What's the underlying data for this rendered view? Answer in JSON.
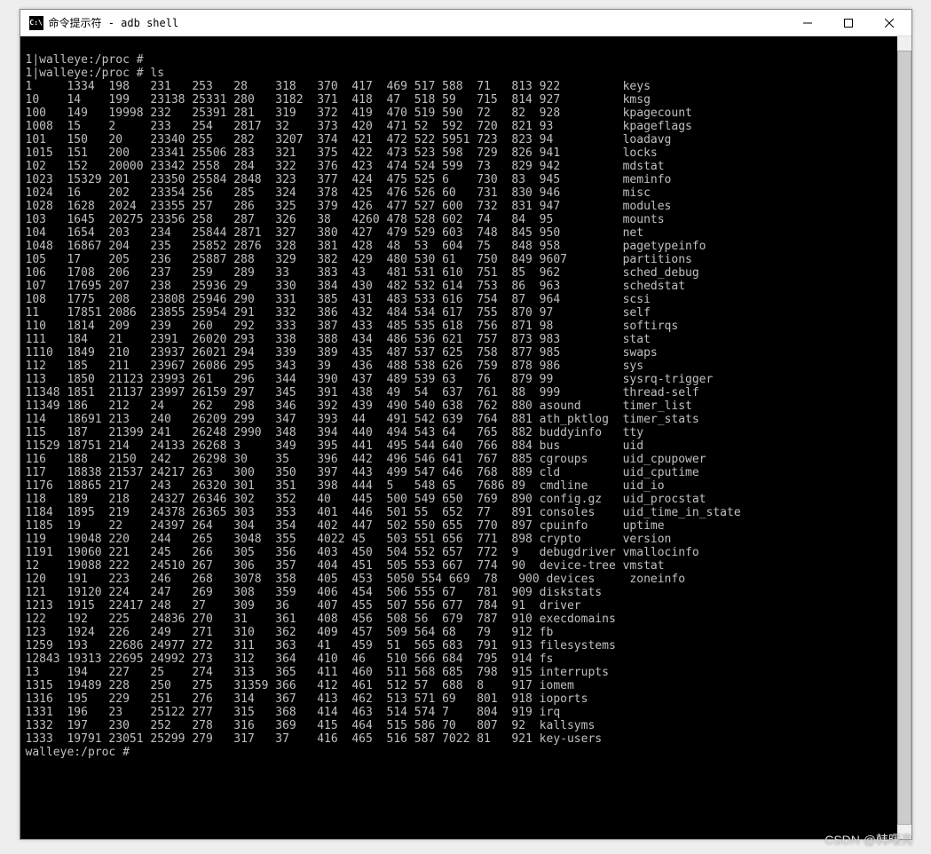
{
  "title": "命令提示符 - adb  shell",
  "prompt1": "1|walleye:/proc #",
  "prompt2": "1|walleye:/proc # ls",
  "prompt3": "walleye:/proc #",
  "cols": [
    [
      "1",
      "10",
      "100",
      "1008",
      "101",
      "1015",
      "102",
      "1023",
      "1024",
      "1028",
      "103",
      "104",
      "1048",
      "105",
      "106",
      "107",
      "108",
      "11",
      "110",
      "111",
      "1110",
      "112",
      "113",
      "11348",
      "11349",
      "114",
      "115",
      "11529",
      "116",
      "117",
      "1176",
      "118",
      "1184",
      "1185",
      "119",
      "1191",
      "12",
      "120",
      "121",
      "1213",
      "122",
      "123",
      "1259",
      "12843",
      "13",
      "1315",
      "1316",
      "1331",
      "1332",
      "1333"
    ],
    [
      "1334",
      "14",
      "149",
      "15",
      "150",
      "151",
      "152",
      "15329",
      "16",
      "1628",
      "1645",
      "1654",
      "16867",
      "17",
      "1708",
      "17695",
      "1775",
      "17851",
      "1814",
      "184",
      "1849",
      "185",
      "1850",
      "1851",
      "186",
      "18691",
      "187",
      "18751",
      "188",
      "18838",
      "18865",
      "189",
      "1895",
      "19",
      "19048",
      "19060",
      "19088",
      "191",
      "19120",
      "1915",
      "192",
      "1924",
      "193",
      "19313",
      "194",
      "19489",
      "195",
      "196",
      "197",
      "19791"
    ],
    [
      "198",
      "199",
      "19998",
      "2",
      "20",
      "200",
      "20000",
      "201",
      "202",
      "2024",
      "20275",
      "203",
      "204",
      "205",
      "206",
      "207",
      "208",
      "2086",
      "209",
      "21",
      "210",
      "211",
      "21123",
      "21137",
      "212",
      "213",
      "21399",
      "214",
      "2150",
      "21537",
      "217",
      "218",
      "219",
      "22",
      "220",
      "221",
      "222",
      "223",
      "224",
      "22417",
      "225",
      "226",
      "22686",
      "22695",
      "227",
      "228",
      "229",
      "23",
      "230",
      "23051"
    ],
    [
      "231",
      "23138",
      "232",
      "233",
      "23340",
      "23341",
      "23342",
      "23350",
      "23354",
      "23355",
      "23356",
      "234",
      "235",
      "236",
      "237",
      "238",
      "23808",
      "23855",
      "239",
      "2391",
      "23937",
      "23967",
      "23993",
      "23997",
      "24",
      "240",
      "241",
      "24133",
      "242",
      "24217",
      "243",
      "24327",
      "24378",
      "24397",
      "244",
      "245",
      "24510",
      "246",
      "247",
      "248",
      "24836",
      "249",
      "24977",
      "24992",
      "25",
      "250",
      "251",
      "25122",
      "252",
      "25299"
    ],
    [
      "253",
      "25331",
      "25391",
      "254",
      "255",
      "25506",
      "2558",
      "25584",
      "256",
      "257",
      "258",
      "25844",
      "25852",
      "25887",
      "259",
      "25936",
      "25946",
      "25954",
      "260",
      "26020",
      "26021",
      "26086",
      "261",
      "26159",
      "262",
      "26209",
      "26248",
      "26268",
      "26298",
      "263",
      "26320",
      "26346",
      "26365",
      "264",
      "265",
      "266",
      "267",
      "268",
      "269",
      "27",
      "270",
      "271",
      "272",
      "273",
      "274",
      "275",
      "276",
      "277",
      "278",
      "279"
    ],
    [
      "28",
      "280",
      "281",
      "2817",
      "282",
      "283",
      "284",
      "2848",
      "285",
      "286",
      "287",
      "2871",
      "2876",
      "288",
      "289",
      "29",
      "290",
      "291",
      "292",
      "293",
      "294",
      "295",
      "296",
      "297",
      "298",
      "299",
      "2990",
      "3",
      "30",
      "300",
      "301",
      "302",
      "303",
      "304",
      "3048",
      "305",
      "306",
      "3078",
      "308",
      "309",
      "31",
      "310",
      "311",
      "312",
      "313",
      "31359",
      "314",
      "315",
      "316",
      "317"
    ],
    [
      "318",
      "3182",
      "319",
      "32",
      "3207",
      "321",
      "322",
      "323",
      "324",
      "325",
      "326",
      "327",
      "328",
      "329",
      "33",
      "330",
      "331",
      "332",
      "333",
      "338",
      "339",
      "343",
      "344",
      "345",
      "346",
      "347",
      "348",
      "349",
      "35",
      "350",
      "351",
      "352",
      "353",
      "354",
      "355",
      "356",
      "357",
      "358",
      "359",
      "36",
      "361",
      "362",
      "363",
      "364",
      "365",
      "366",
      "367",
      "368",
      "369",
      "37"
    ],
    [
      "370",
      "371",
      "372",
      "373",
      "374",
      "375",
      "376",
      "377",
      "378",
      "379",
      "38",
      "380",
      "381",
      "382",
      "383",
      "384",
      "385",
      "386",
      "387",
      "388",
      "389",
      "39",
      "390",
      "391",
      "392",
      "393",
      "394",
      "395",
      "396",
      "397",
      "398",
      "40",
      "401",
      "402",
      "4022",
      "403",
      "404",
      "405",
      "406",
      "407",
      "408",
      "409",
      "41",
      "410",
      "411",
      "412",
      "413",
      "414",
      "415",
      "416"
    ],
    [
      "417",
      "418",
      "419",
      "420",
      "421",
      "422",
      "423",
      "424",
      "425",
      "426",
      "4260",
      "427",
      "428",
      "429",
      "43",
      "430",
      "431",
      "432",
      "433",
      "434",
      "435",
      "436",
      "437",
      "438",
      "439",
      "44",
      "440",
      "441",
      "442",
      "443",
      "444",
      "445",
      "446",
      "447",
      "45",
      "450",
      "451",
      "453",
      "454",
      "455",
      "456",
      "457",
      "459",
      "46",
      "460",
      "461",
      "462",
      "463",
      "464",
      "465"
    ],
    [
      "469",
      "47",
      "470",
      "471",
      "472",
      "473",
      "474",
      "475",
      "476",
      "477",
      "478",
      "479",
      "48",
      "480",
      "481",
      "482",
      "483",
      "484",
      "485",
      "486",
      "487",
      "488",
      "489",
      "49",
      "490",
      "491",
      "494",
      "495",
      "496",
      "499",
      "5",
      "500",
      "501",
      "502",
      "503",
      "504",
      "505",
      "5050",
      "506",
      "507",
      "508",
      "509",
      "51",
      "510",
      "511",
      "512",
      "513",
      "514",
      "515",
      "516"
    ],
    [
      "517",
      "518",
      "519",
      "52",
      "522",
      "523",
      "524",
      "525",
      "526",
      "527",
      "528",
      "529",
      "53",
      "530",
      "531",
      "532",
      "533",
      "534",
      "535",
      "536",
      "537",
      "538",
      "539",
      "54",
      "540",
      "542",
      "543",
      "544",
      "546",
      "547",
      "548",
      "549",
      "55",
      "550",
      "551",
      "552",
      "553",
      "554",
      "555",
      "556",
      "56",
      "564",
      "565",
      "566",
      "568",
      "57",
      "571",
      "574",
      "586",
      "587"
    ],
    [
      "588",
      "59",
      "590",
      "592",
      "5951",
      "598",
      "599",
      "6",
      "60",
      "600",
      "602",
      "603",
      "604",
      "61",
      "610",
      "614",
      "616",
      "617",
      "618",
      "621",
      "625",
      "626",
      "63",
      "637",
      "638",
      "639",
      "64",
      "640",
      "641",
      "646",
      "65",
      "650",
      "652",
      "655",
      "656",
      "657",
      "667",
      "669",
      "67",
      "677",
      "679",
      "68",
      "683",
      "684",
      "685",
      "688",
      "69",
      "7",
      "70",
      "7022"
    ],
    [
      "71",
      "715",
      "72",
      "720",
      "723",
      "729",
      "73",
      "730",
      "731",
      "732",
      "74",
      "748",
      "75",
      "750",
      "751",
      "753",
      "754",
      "755",
      "756",
      "757",
      "758",
      "759",
      "76",
      "761",
      "762",
      "764",
      "765",
      "766",
      "767",
      "768",
      "7686",
      "769",
      "77",
      "770",
      "771",
      "772",
      "774",
      "78",
      "781",
      "784",
      "787",
      "79",
      "791",
      "795",
      "798",
      "8",
      "801",
      "804",
      "807",
      "81"
    ],
    [
      "813",
      "814",
      "82",
      "821",
      "823",
      "826",
      "829",
      "83",
      "830",
      "831",
      "84",
      "845",
      "848",
      "849",
      "85",
      "86",
      "87",
      "870",
      "871",
      "873",
      "877",
      "878",
      "879",
      "88",
      "880",
      "881",
      "882",
      "884",
      "885",
      "889",
      "89",
      "890",
      "891",
      "897",
      "898",
      "9",
      "90",
      "900",
      "909",
      "91",
      "910",
      "912",
      "913",
      "914",
      "915",
      "917",
      "918",
      "919",
      "92",
      "921"
    ],
    [
      "922",
      "927",
      "928",
      "93",
      "94",
      "941",
      "942",
      "945",
      "946",
      "947",
      "95",
      "950",
      "958",
      "9607",
      "962",
      "963",
      "964",
      "97",
      "98",
      "983",
      "985",
      "986",
      "99",
      "999",
      "asound",
      "ath_pktlog",
      "buddyinfo",
      "bus",
      "cgroups",
      "cld",
      "cmdline",
      "config.gz",
      "consoles",
      "cpuinfo",
      "crypto",
      "debugdriver",
      "device-tree",
      "devices",
      "diskstats",
      "driver",
      "execdomains",
      "fb",
      "filesystems",
      "fs",
      "interrupts",
      "iomem",
      "ioports",
      "irq",
      "kallsyms",
      "key-users"
    ],
    [
      "keys",
      "kmsg",
      "kpagecount",
      "kpageflags",
      "loadavg",
      "locks",
      "mdstat",
      "meminfo",
      "misc",
      "modules",
      "mounts",
      "net",
      "pagetypeinfo",
      "partitions",
      "sched_debug",
      "schedstat",
      "scsi",
      "self",
      "softirqs",
      "stat",
      "swaps",
      "sys",
      "sysrq-trigger",
      "thread-self",
      "timer_list",
      "timer_stats",
      "tty",
      "uid",
      "uid_cpupower",
      "uid_cputime",
      "uid_io",
      "uid_procstat",
      "uid_time_in_state",
      "uptime",
      "version",
      "vmallocinfo",
      "vmstat",
      "zoneinfo",
      "",
      "",
      "",
      "",
      "",
      "",
      "",
      "",
      "",
      "",
      "",
      ""
    ]
  ],
  "watermark": "CSDN @韩曙亮"
}
